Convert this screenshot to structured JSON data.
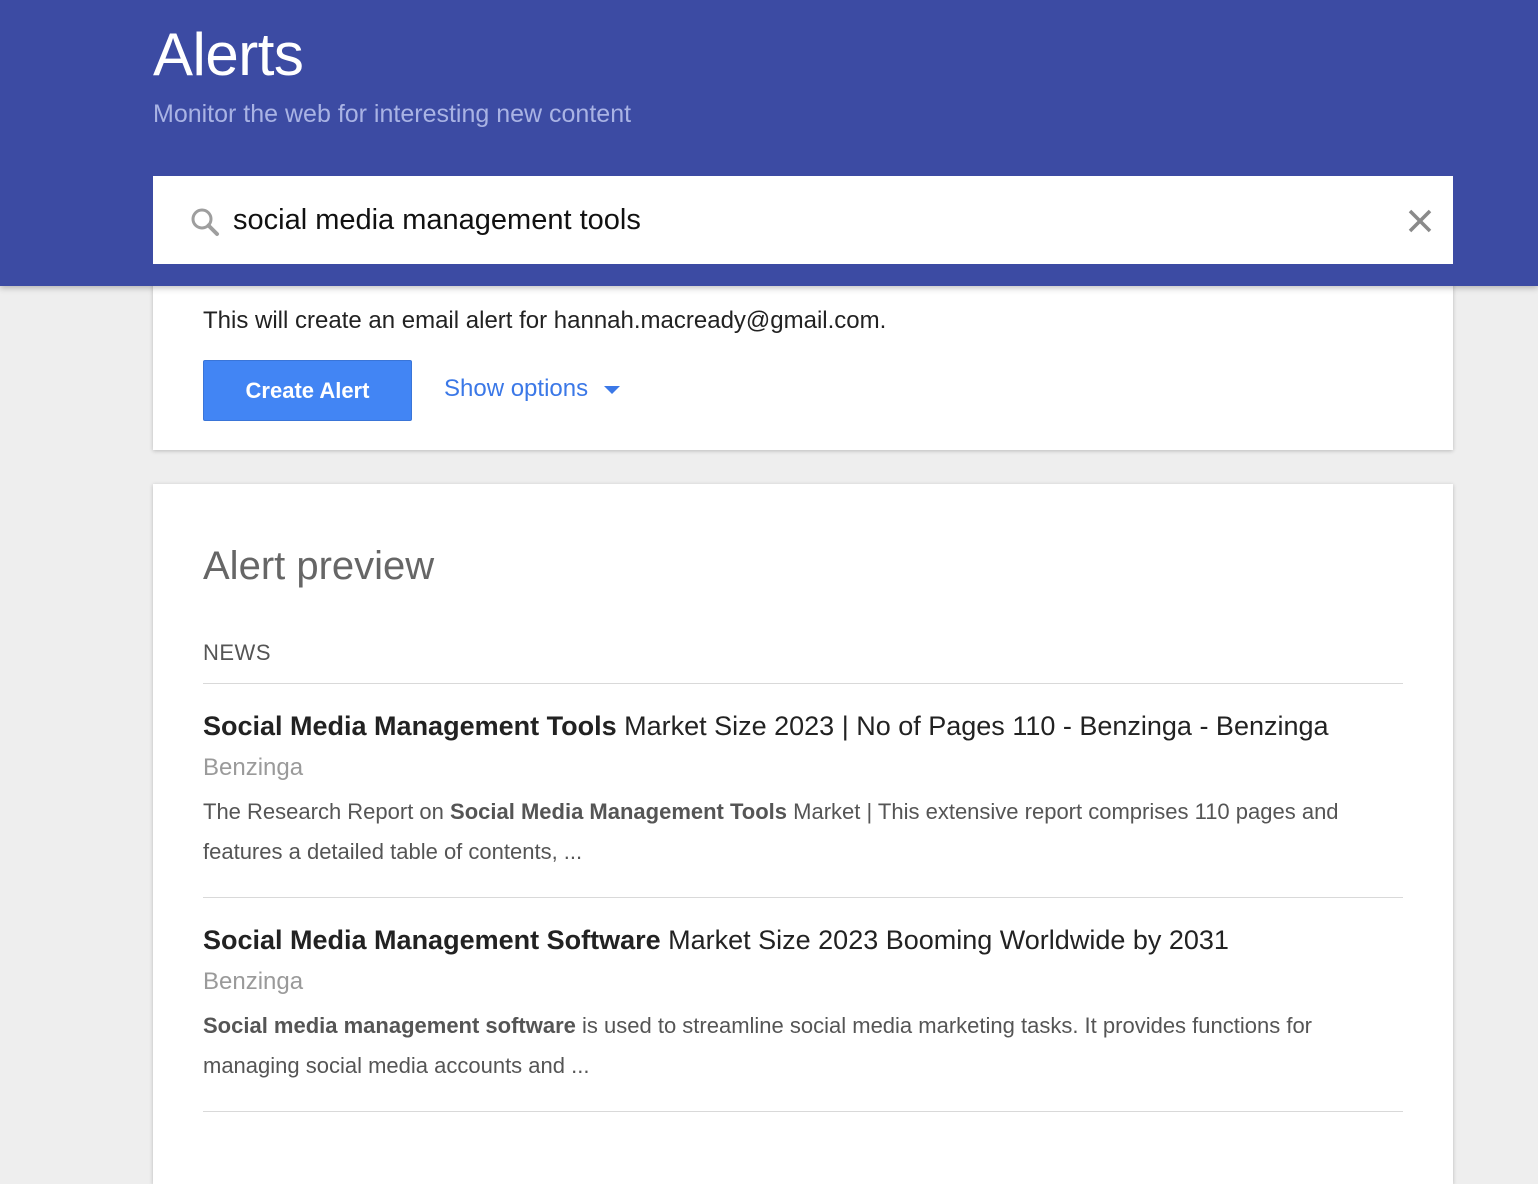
{
  "header": {
    "title": "Alerts",
    "subtitle": "Monitor the web for interesting new content"
  },
  "search": {
    "query": "social media management tools",
    "search_icon": "search-icon",
    "clear_icon": "close-icon"
  },
  "create": {
    "email_notice": "This will create an email alert for hannah.macready@gmail.com.",
    "create_label": "Create Alert",
    "options_label": "Show options",
    "options_icon": "caret-down-icon"
  },
  "preview": {
    "title": "Alert preview",
    "section": "NEWS",
    "results": [
      {
        "title_bold": "Social Media Management Tools",
        "title_rest": " Market Size 2023 | No of Pages 110 - Benzinga - Benzinga",
        "source": "Benzinga",
        "snippet_pre": "The Research Report on ",
        "snippet_bold": "Social Media Management Tools",
        "snippet_post": " Market | This extensive report comprises 110 pages and features a detailed table of contents, ..."
      },
      {
        "title_bold": "Social Media Management Software",
        "title_rest": " Market Size 2023 Booming Worldwide by 2031",
        "source": "Benzinga",
        "snippet_pre": "",
        "snippet_bold": "Social media management software",
        "snippet_post": " is used to streamline social media marketing tasks. It provides functions for managing social media accounts and ..."
      }
    ]
  },
  "colors": {
    "header_bg": "#3c4ba3",
    "button_bg": "#4285f4",
    "link": "#3b78e7",
    "page_bg": "#eeeeee"
  }
}
